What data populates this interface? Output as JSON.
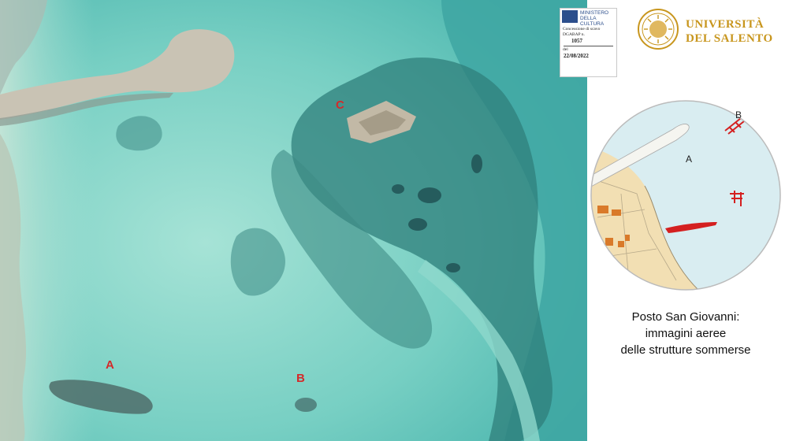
{
  "aerial_labels": {
    "a": "A",
    "b": "B",
    "c": "C"
  },
  "permit": {
    "ministry_line1": "MINISTERO",
    "ministry_line2": "DELLA",
    "ministry_line3": "CULTURA",
    "concession": "Concessione di scavo",
    "code_label": "DGABAP n.",
    "number": "1057",
    "date_label": "del",
    "date": "22/08/2022"
  },
  "university": {
    "name_line1": "UNIVERSITÀ",
    "name_line2": "DEL SALENTO"
  },
  "inset_labels": {
    "a": "A",
    "b": "B"
  },
  "caption": {
    "line1": "Posto San Giovanni:",
    "line2": "immagini aeree",
    "line3": "delle strutture sommerse"
  },
  "colors": {
    "sea_light": "#8fd8cc",
    "sea_mid": "#5cc0b6",
    "seagrass": "#2f7f7b",
    "label_red": "#d42a2a",
    "gold": "#c8961e",
    "inset_sea": "#d9edf1",
    "inset_land": "#f2dfb3",
    "inset_structure": "#d42020",
    "inset_building": "#d97a2a"
  }
}
